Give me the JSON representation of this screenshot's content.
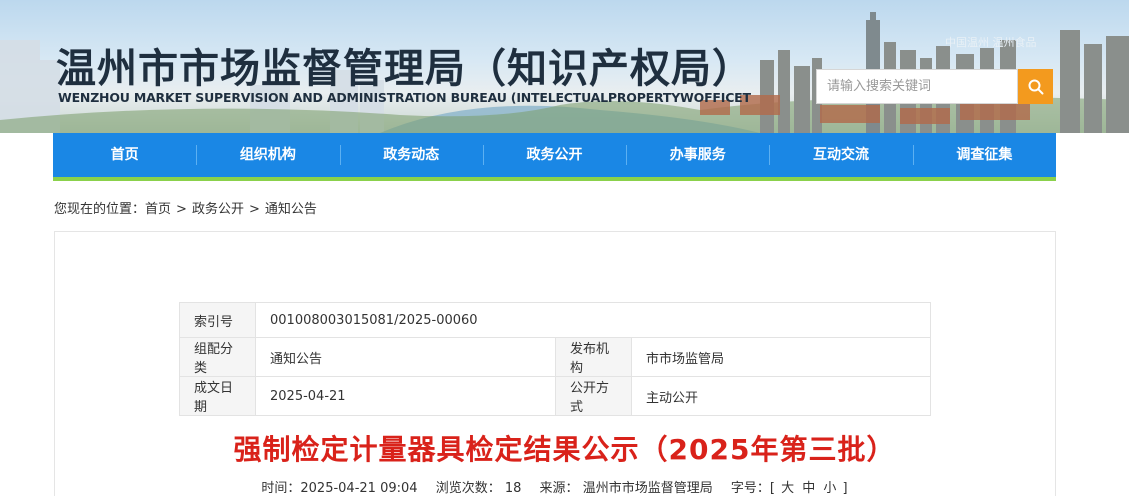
{
  "header": {
    "title": "温州市市场监督管理局（知识产权局）",
    "subtitle": "WENZHOU MARKET SUPERVISION AND ADMINISTRATION BUREAU (INTELECTUALPROPERTYWOFFICET",
    "top_links": "中国温州  温州食品",
    "search_placeholder": "请输入搜索关键词"
  },
  "nav": {
    "items": [
      "首页",
      "组织机构",
      "政务动态",
      "政务公开",
      "办事服务",
      "互动交流",
      "调查征集"
    ]
  },
  "breadcrumb": {
    "prefix": "您现在的位置：",
    "items": [
      "首页",
      "政务公开",
      "通知公告"
    ],
    "separator": ">"
  },
  "meta": {
    "index_label": "索引号",
    "index_value": "001008003015081/2025-00060",
    "category_label": "组配分类",
    "category_value": "通知公告",
    "publisher_label": "发布机构",
    "publisher_value": "市市场监管局",
    "date_label": "成文日期",
    "date_value": "2025-04-21",
    "open_label": "公开方式",
    "open_value": "主动公开"
  },
  "article": {
    "title": "强制检定计量器具检定结果公示（2025年第三批）",
    "time_label": "时间：",
    "time_value": "2025-04-21 09:04",
    "views_label": "浏览次数：",
    "views_value": "18",
    "source_label": "来源：",
    "source_value": "温州市市场监督管理局",
    "fontsize_label": "字号：",
    "fontsize_open": "[",
    "fontsize_large": "大",
    "fontsize_medium": "中",
    "fontsize_small": "小",
    "fontsize_close": "]"
  },
  "colors": {
    "nav_bg": "#1a87e5",
    "nav_underline": "#8bd14b",
    "search_button": "#f39a1e",
    "title_red": "#d9221a"
  }
}
